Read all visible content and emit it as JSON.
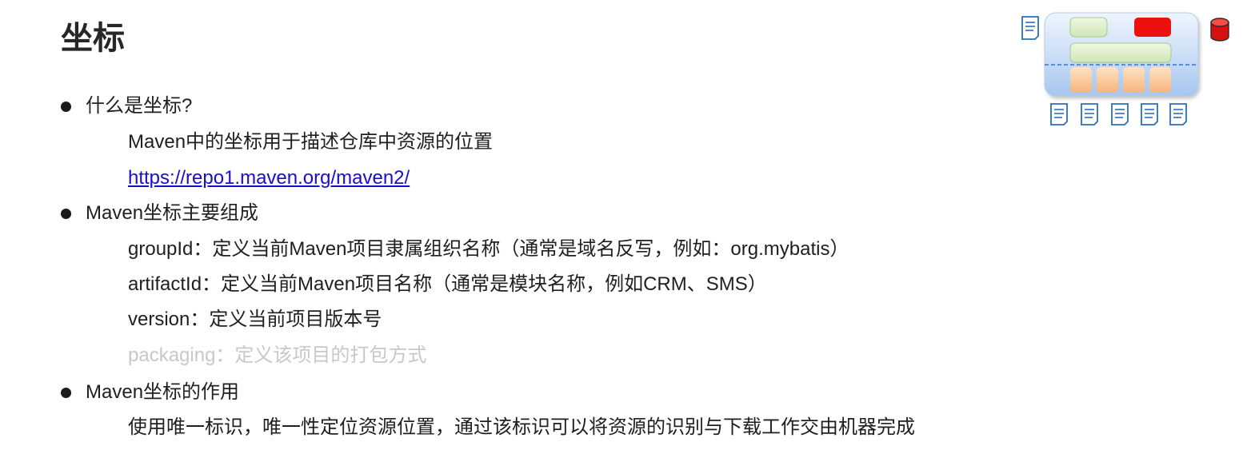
{
  "page": {
    "title": "坐标"
  },
  "sections": [
    {
      "heading": "什么是坐标?",
      "lines": [
        {
          "text": "Maven中的坐标用于描述仓库中资源的位置"
        },
        {
          "text": "https://repo1.maven.org/maven2/",
          "type": "link"
        }
      ]
    },
    {
      "heading": "Maven坐标主要组成",
      "lines": [
        {
          "text": "groupId：定义当前Maven项目隶属组织名称（通常是域名反写，例如：org.mybatis）"
        },
        {
          "text": "artifactId：定义当前Maven项目名称（通常是模块名称，例如CRM、SMS）"
        },
        {
          "text": "version：定义当前项目版本号"
        },
        {
          "text": "packaging：定义该项目的打包方式",
          "state": "faded"
        }
      ]
    },
    {
      "heading": "Maven坐标的作用",
      "lines": [
        {
          "text": "使用唯一标识，唯一性定位资源位置，通过该标识可以将资源的识别与下载工作交由机器完成"
        }
      ]
    }
  ],
  "diagram": {
    "icons": [
      "document-icon",
      "repository-panel-icon",
      "database-icon",
      "document-icon",
      "document-icon",
      "document-icon",
      "document-icon",
      "document-icon"
    ],
    "colors": {
      "panel_top": "#dbe8fb",
      "panel_bottom": "#a9c8f2",
      "green_box": "#dcefc8",
      "red_box": "#ee0f0f",
      "orange_box": "#f9c89b",
      "doc_stroke": "#2a6fc0",
      "db_red": "#d80f0f"
    }
  }
}
